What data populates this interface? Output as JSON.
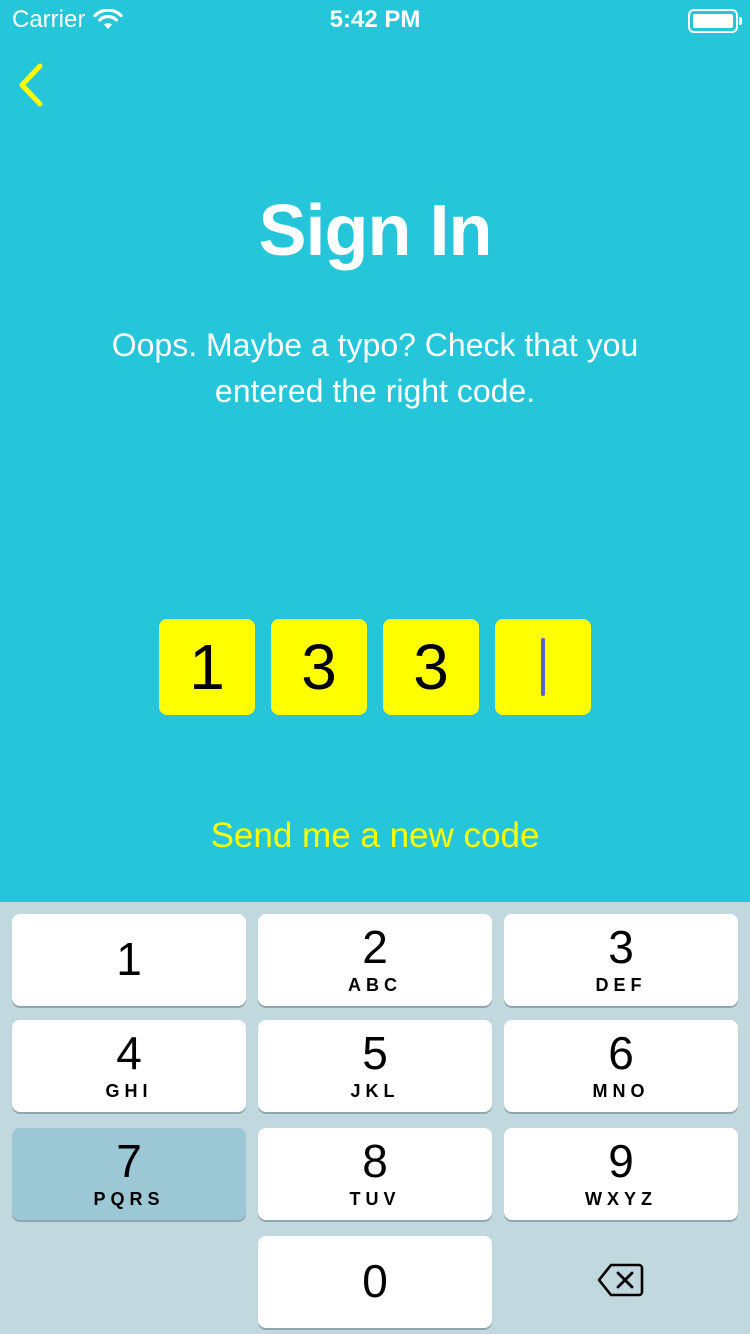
{
  "status_bar": {
    "carrier": "Carrier",
    "time": "5:42 PM"
  },
  "nav": {
    "back_icon": "chevron-left-icon"
  },
  "title": "Sign In",
  "message": "Oops. Maybe a typo? Check that you entered the right code.",
  "code": {
    "digits": [
      "1",
      "3",
      "3",
      ""
    ],
    "active_index": 3
  },
  "resend_label": "Send me a new code",
  "keypad": {
    "keys": [
      {
        "num": "1",
        "letters": ""
      },
      {
        "num": "2",
        "letters": "ABC"
      },
      {
        "num": "3",
        "letters": "DEF"
      },
      {
        "num": "4",
        "letters": "GHI"
      },
      {
        "num": "5",
        "letters": "JKL"
      },
      {
        "num": "6",
        "letters": "MNO"
      },
      {
        "num": "7",
        "letters": "PQRS"
      },
      {
        "num": "8",
        "letters": "TUV"
      },
      {
        "num": "9",
        "letters": "WXYZ"
      },
      {
        "num": "0",
        "letters": ""
      }
    ],
    "pressed_key": "7",
    "delete_icon": "backspace-icon"
  },
  "colors": {
    "background": "#25c6d9",
    "accent": "#ffff00",
    "keyboard_bg": "#c2d8df",
    "pressed_key": "#9cc8d6"
  }
}
